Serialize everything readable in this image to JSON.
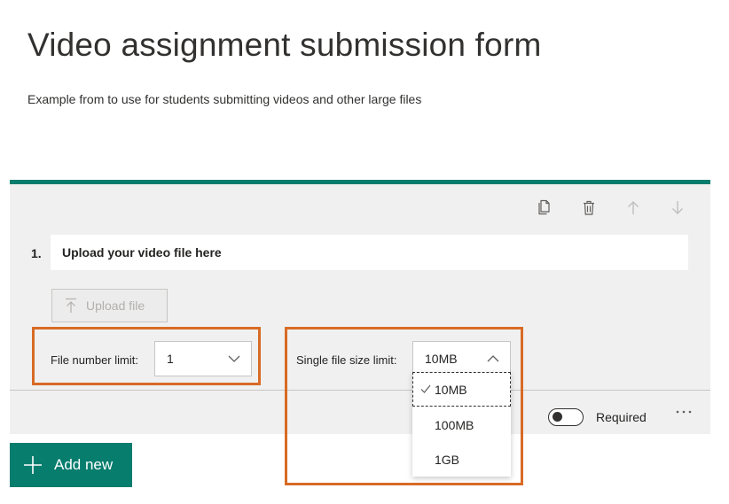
{
  "form": {
    "title": "Video assignment submission form",
    "description": "Example from to use for students submitting videos and other large files"
  },
  "question": {
    "number": "1.",
    "title": "Upload your video file here",
    "upload_button_label": "Upload file",
    "file_number_limit": {
      "label": "File number limit:",
      "selected": "1"
    },
    "single_file_size_limit": {
      "label": "Single file size limit:",
      "selected": "10MB",
      "options": [
        "10MB",
        "100MB",
        "1GB"
      ]
    },
    "required_label": "Required",
    "toolbar_icons": [
      "copy-icon",
      "delete-icon",
      "move-up-icon",
      "move-down-icon"
    ]
  },
  "add_new_label": "Add new",
  "colors": {
    "accent": "#077d6e",
    "highlight": "#d86b26"
  }
}
